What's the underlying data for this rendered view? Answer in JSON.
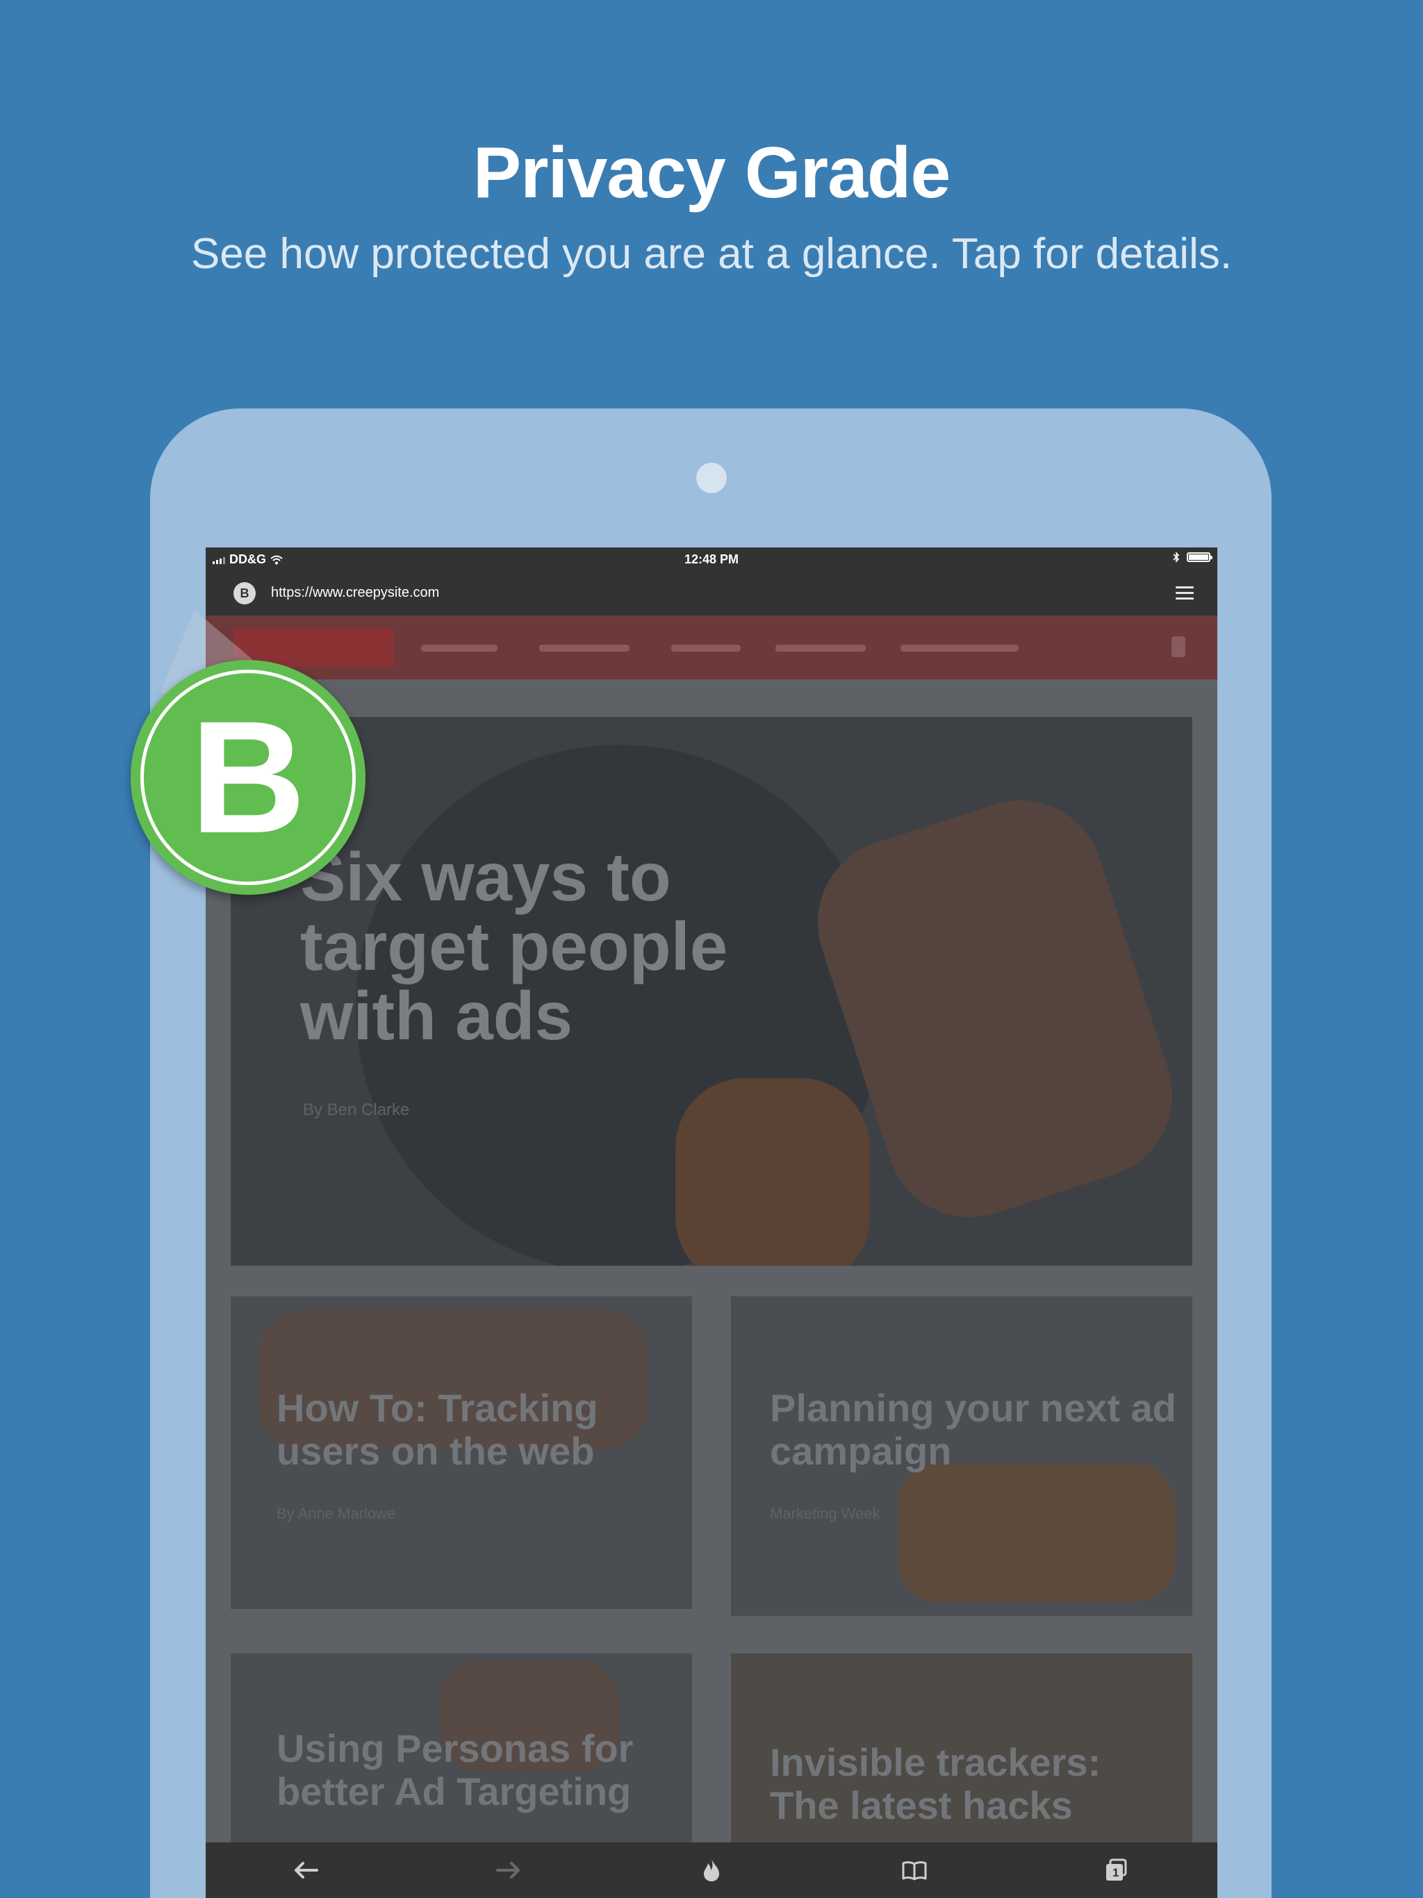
{
  "promo": {
    "title": "Privacy Grade",
    "subtitle": "See how protected you are at a glance. Tap for details."
  },
  "status_bar": {
    "carrier": "DD&G",
    "time": "12:48 PM"
  },
  "browser": {
    "url": "https://www.creepysite.com",
    "mini_grade": "B",
    "grade": "B",
    "grade_color": "#62bd51",
    "tab_count": "1"
  },
  "page": {
    "hero_title": "Six ways to target people with ads",
    "hero_byline": "By Ben Clarke",
    "cards": [
      {
        "title": "How To: Tracking users on the web",
        "sub": "By Anne Marlowe"
      },
      {
        "title": "Planning your next ad campaign",
        "sub": "Marketing Week"
      },
      {
        "title": "Using Personas for better Ad Targeting",
        "sub": ""
      },
      {
        "title": "Invisible trackers: The latest hacks",
        "sub": ""
      }
    ]
  },
  "toolbar": {
    "icons": [
      "back-arrow-icon",
      "forward-arrow-icon",
      "fire-icon",
      "bookmarks-icon",
      "tabs-icon"
    ]
  },
  "colors": {
    "background": "#3a7db3",
    "device": "#9dbedc",
    "bars": "#333333"
  }
}
